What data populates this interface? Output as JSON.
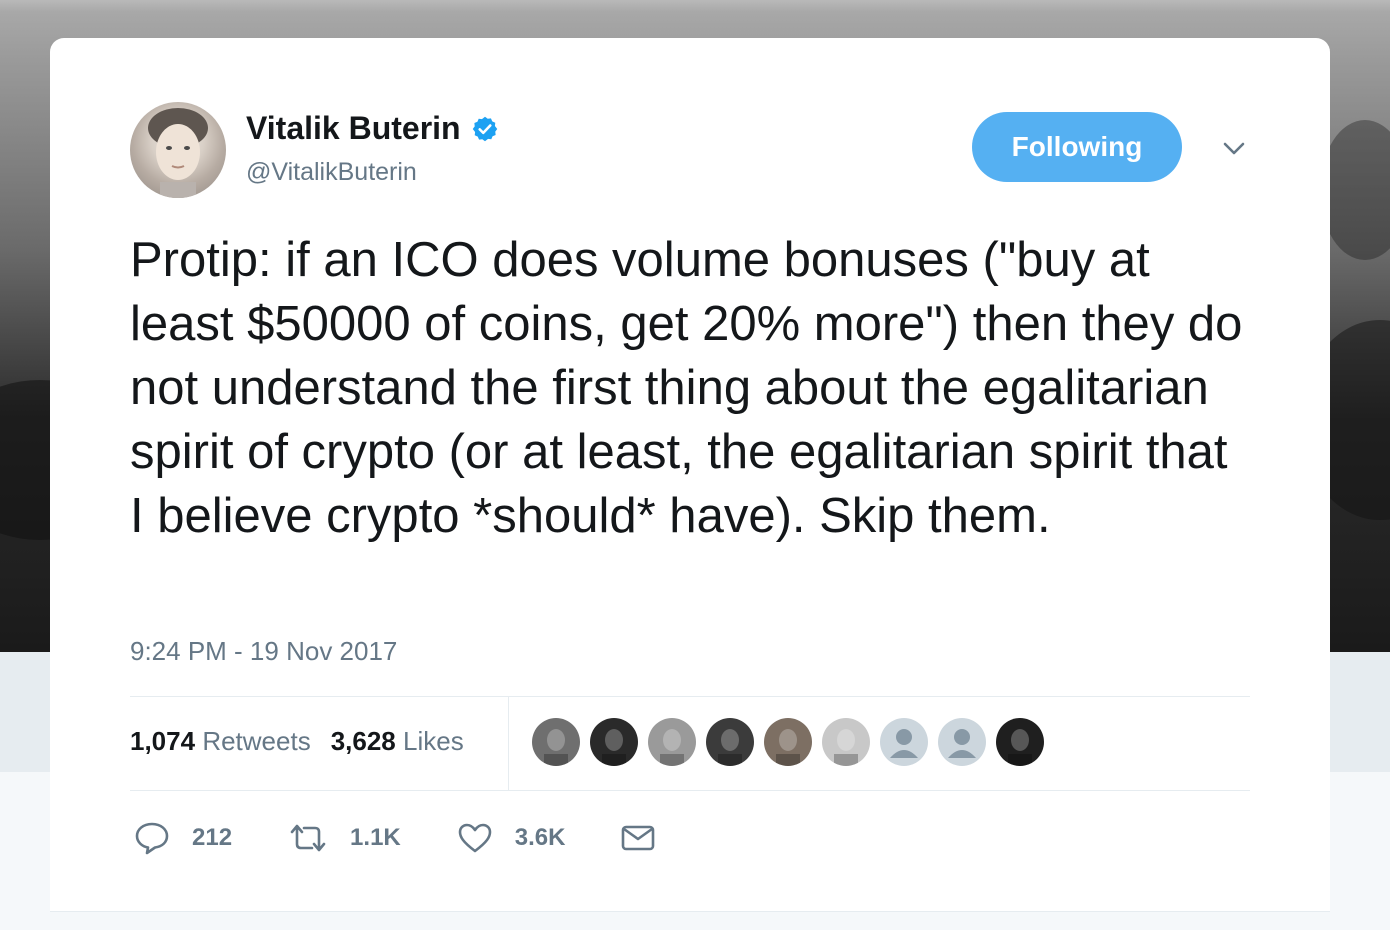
{
  "user": {
    "name": "Vitalik Buterin",
    "handle": "@VitalikButerin",
    "verified": true
  },
  "follow_button": {
    "label": "Following",
    "color": "#55b0f2"
  },
  "tweet": {
    "text": "Protip: if an ICO does volume bonuses (\"buy at least $50000 of coins, get 20% more\") then they do not understand the first thing about the egalitarian spirit of crypto (or at least, the egalitarian spirit that I believe crypto *should* have). Skip them.",
    "timestamp": "9:24 PM - 19 Nov 2017"
  },
  "stats": {
    "retweets_count": "1,074",
    "retweets_label": "Retweets",
    "likes_count": "3,628",
    "likes_label": "Likes"
  },
  "likers": [
    {
      "icon": "liker-avatar",
      "color": "#6f6f6f"
    },
    {
      "icon": "liker-avatar",
      "color": "#2a2a2a"
    },
    {
      "icon": "liker-avatar",
      "color": "#9a9a9a"
    },
    {
      "icon": "liker-avatar",
      "color": "#3b3b3b"
    },
    {
      "icon": "liker-avatar",
      "color": "#7d6f63"
    },
    {
      "icon": "liker-avatar",
      "color": "#c8c8c8"
    },
    {
      "icon": "default-avatar",
      "color": "#ccd6dd"
    },
    {
      "icon": "default-avatar",
      "color": "#ccd6dd"
    },
    {
      "icon": "liker-avatar",
      "color": "#1f1f1f"
    }
  ],
  "actions": {
    "replies": "212",
    "retweets": "1.1K",
    "likes": "3.6K",
    "icons": [
      "reply-icon",
      "retweet-icon",
      "like-icon",
      "direct-message-icon"
    ]
  },
  "colors": {
    "text_primary": "#14171a",
    "text_secondary": "#657786",
    "accent": "#1da1f2",
    "divider": "#e6ecf0"
  }
}
